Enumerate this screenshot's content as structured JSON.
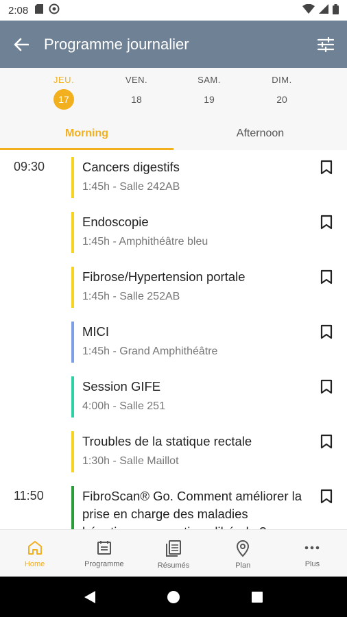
{
  "status_bar": {
    "time": "2:08"
  },
  "app_bar": {
    "title": "Programme journalier"
  },
  "days": [
    {
      "name": "JEU.",
      "num": "17",
      "active": true
    },
    {
      "name": "VEN.",
      "num": "18",
      "active": false
    },
    {
      "name": "SAM.",
      "num": "19",
      "active": false
    },
    {
      "name": "DIM.",
      "num": "20",
      "active": false
    }
  ],
  "tabs": [
    {
      "label": "Morning",
      "active": true
    },
    {
      "label": "Afternoon",
      "active": false
    }
  ],
  "sessions": [
    {
      "time": "09:30",
      "title": "Cancers digestifs",
      "subtitle": "1:45h - Salle 242AB",
      "color": "#f5d320"
    },
    {
      "time": "",
      "title": "Endoscopie",
      "subtitle": "1:45h - Amphithéâtre bleu",
      "color": "#f5d320"
    },
    {
      "time": "",
      "title": "Fibrose/Hypertension portale",
      "subtitle": "1:45h - Salle 252AB",
      "color": "#f5d320"
    },
    {
      "time": "",
      "title": "MICI",
      "subtitle": "1:45h - Grand Amphithéâtre",
      "color": "#7f9ee6"
    },
    {
      "time": "",
      "title": "Session GIFE",
      "subtitle": "4:00h - Salle 251",
      "color": "#2ed1a6"
    },
    {
      "time": "",
      "title": "Troubles de la statique rectale",
      "subtitle": "1:30h - Salle Maillot",
      "color": "#f5d320"
    },
    {
      "time": "11:50",
      "title": "FibroScan® Go. Comment améliorer la prise en charge des maladies hépatiques en pratique libérale ?",
      "subtitle": "",
      "color": "#2a9d3a"
    }
  ],
  "bottom_nav": [
    {
      "label": "Home",
      "icon": "home-icon",
      "active": true
    },
    {
      "label": "Programme",
      "icon": "calendar-list-icon",
      "active": false
    },
    {
      "label": "Résumés",
      "icon": "documents-icon",
      "active": false
    },
    {
      "label": "Plan",
      "icon": "map-pin-icon",
      "active": false
    },
    {
      "label": "Plus",
      "icon": "more-icon",
      "active": false
    }
  ],
  "colors": {
    "accent": "#f2b01e",
    "app_bar": "#6f8195"
  }
}
